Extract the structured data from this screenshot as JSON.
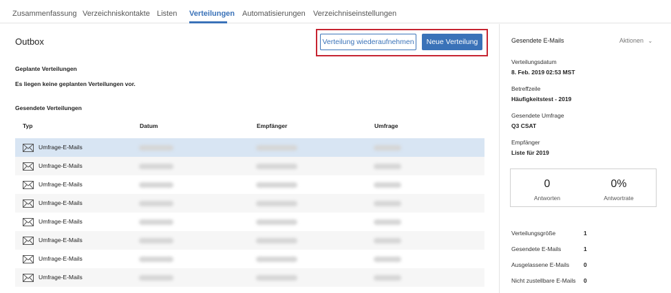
{
  "nav": {
    "tabs": [
      {
        "label": "Zusammenfassung"
      },
      {
        "label": "Verzeichniskontakte"
      },
      {
        "label": "Listen"
      },
      {
        "label": "Verteilungen",
        "active": true
      },
      {
        "label": "Automatisierungen"
      },
      {
        "label": "Verzeichniseinstellungen"
      }
    ]
  },
  "main": {
    "title": "Outbox",
    "resume_button": "Verteilung wiederaufnehmen",
    "new_button": "Neue Verteilung",
    "scheduled_label": "Geplante Verteilungen",
    "scheduled_empty": "Es liegen keine geplanten Verteilungen vor.",
    "sent_label": "Gesendete Verteilungen",
    "columns": [
      "Typ",
      "Datum",
      "Empfänger",
      "Umfrage"
    ],
    "rows": [
      {
        "type": "Umfrage-E-Mails"
      },
      {
        "type": "Umfrage-E-Mails"
      },
      {
        "type": "Umfrage-E-Mails"
      },
      {
        "type": "Umfrage-E-Mails"
      },
      {
        "type": "Umfrage-E-Mails"
      },
      {
        "type": "Umfrage-E-Mails"
      },
      {
        "type": "Umfrage-E-Mails"
      },
      {
        "type": "Umfrage-E-Mails"
      }
    ]
  },
  "sidebar": {
    "title": "Gesendete E-Mails",
    "actions": "Aktionen",
    "details": [
      {
        "label": "Verteilungsdatum",
        "value": "8. Feb. 2019 02:53 MST"
      },
      {
        "label": "Betreffzeile",
        "value": "Häufigkeitstest - 2019"
      },
      {
        "label": "Gesendete Umfrage",
        "value": "Q3 CSAT"
      },
      {
        "label": "Empfänger",
        "value": "Liste für 2019"
      }
    ],
    "stats": [
      {
        "value": "0",
        "label": "Antworten"
      },
      {
        "value": "0%",
        "label": "Antwortrate"
      }
    ],
    "summary": [
      {
        "label": "Verteilungsgröße",
        "value": "1"
      },
      {
        "label": "Gesendete E-Mails",
        "value": "1"
      },
      {
        "label": "Ausgelassene E-Mails",
        "value": "0"
      },
      {
        "label": "Nicht zustellbare E-Mails",
        "value": "0"
      }
    ]
  },
  "colors": {
    "accent": "#3a72b8",
    "highlight": "#c62330",
    "selected_row": "#d8e5f3"
  }
}
